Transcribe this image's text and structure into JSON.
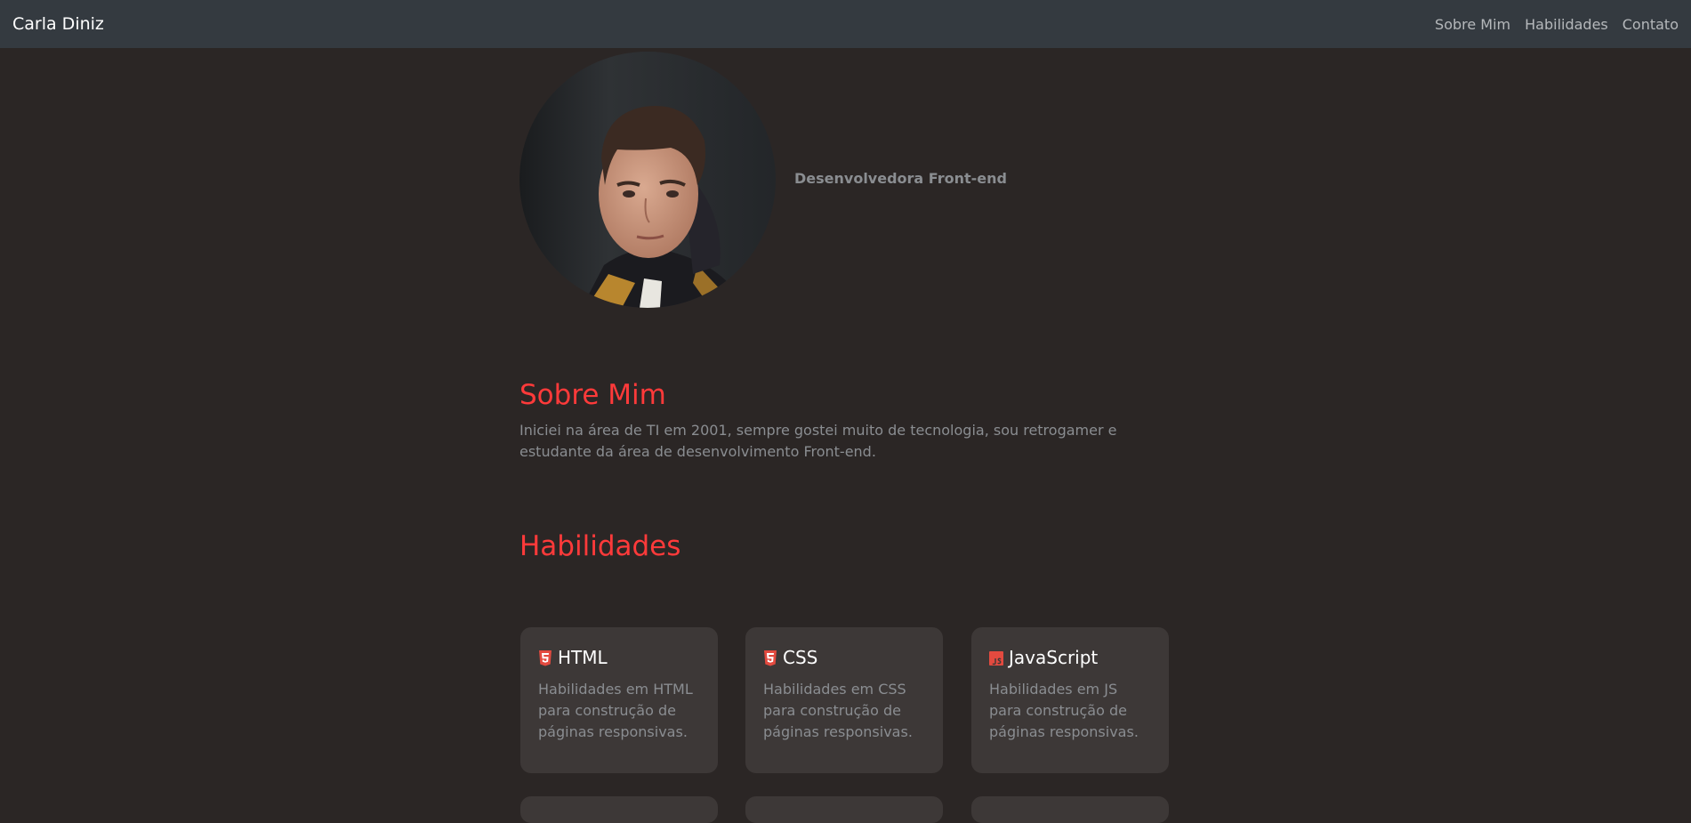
{
  "navbar": {
    "brand": "Carla Diniz",
    "links": [
      "Sobre Mim",
      "Habilidades",
      "Contato"
    ]
  },
  "profile": {
    "role": "Desenvolvedora Front-end"
  },
  "about": {
    "title": "Sobre Mim",
    "text": "Iniciei na área de TI em 2001, sempre gostei muito de tecnologia, sou retrogamer e estudante da área de desenvolvimento Front-end."
  },
  "skills": {
    "title": "Habilidades",
    "cards": [
      {
        "icon": "html5-icon",
        "title": "HTML",
        "text": "Habilidades em HTML para construção de páginas responsivas."
      },
      {
        "icon": "css3-icon",
        "title": "CSS",
        "text": "Habilidades em CSS para construção de páginas responsivas."
      },
      {
        "icon": "javascript-icon",
        "title": "JavaScript",
        "text": "Habilidades em JS para construção de páginas responsivas."
      }
    ]
  },
  "colors": {
    "background": "#2b2625",
    "navbar": "#343a40",
    "accent": "#ff3a3a",
    "card": "#3d3837",
    "muted_text": "#8a8d91"
  }
}
